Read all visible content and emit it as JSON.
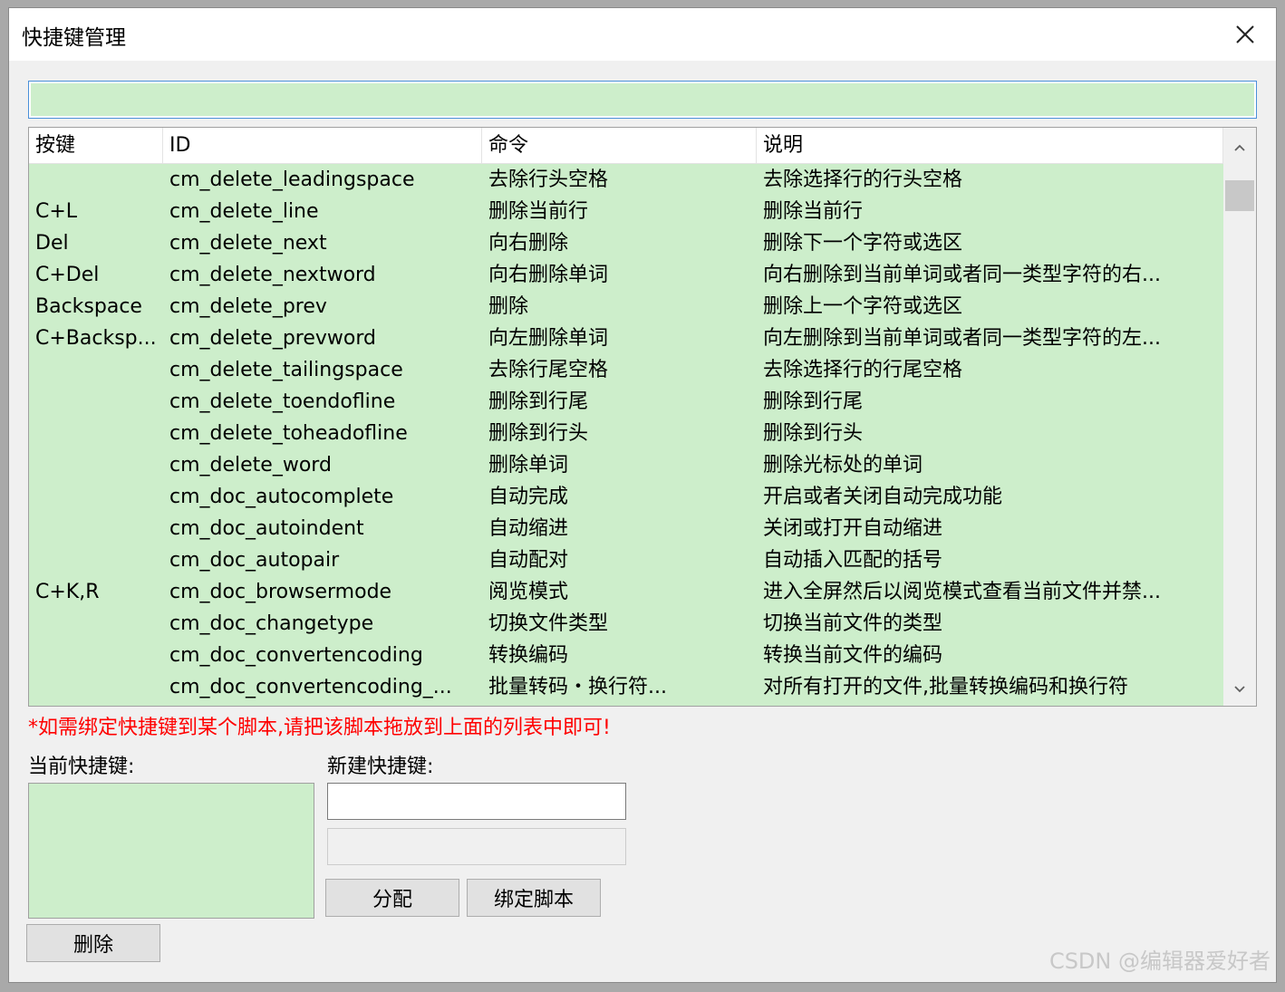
{
  "window": {
    "title": "快捷键管理"
  },
  "filter": {
    "value": ""
  },
  "columns": [
    "按键",
    "ID",
    "命令",
    "说明"
  ],
  "rows": [
    [
      "",
      "cm_delete_leadingspace",
      "去除行头空格",
      "去除选择行的行头空格"
    ],
    [
      "C+L",
      "cm_delete_line",
      "删除当前行",
      "删除当前行"
    ],
    [
      "Del",
      "cm_delete_next",
      "向右删除",
      "删除下一个字符或选区"
    ],
    [
      "C+Del",
      "cm_delete_nextword",
      "向右删除单词",
      "向右删除到当前单词或者同一类型字符的右..."
    ],
    [
      "Backspace",
      "cm_delete_prev",
      "删除",
      "删除上一个字符或选区"
    ],
    [
      "C+Backsp...",
      "cm_delete_prevword",
      "向左删除单词",
      "向左删除到当前单词或者同一类型字符的左..."
    ],
    [
      "",
      "cm_delete_tailingspace",
      "去除行尾空格",
      "去除选择行的行尾空格"
    ],
    [
      "",
      "cm_delete_toendofline",
      "删除到行尾",
      "删除到行尾"
    ],
    [
      "",
      "cm_delete_toheadofline",
      "删除到行头",
      "删除到行头"
    ],
    [
      "",
      "cm_delete_word",
      "删除单词",
      "删除光标处的单词"
    ],
    [
      "",
      "cm_doc_autocomplete",
      "自动完成",
      "开启或者关闭自动完成功能"
    ],
    [
      "",
      "cm_doc_autoindent",
      "自动缩进",
      "关闭或打开自动缩进"
    ],
    [
      "",
      "cm_doc_autopair",
      "自动配对",
      "自动插入匹配的括号"
    ],
    [
      "C+K,R",
      "cm_doc_browsermode",
      "阅览模式",
      "进入全屏然后以阅览模式查看当前文件并禁..."
    ],
    [
      "",
      "cm_doc_changetype",
      "切换文件类型",
      "切换当前文件的类型"
    ],
    [
      "",
      "cm_doc_convertencoding",
      "转换编码",
      "转换当前文件的编码"
    ],
    [
      "",
      "cm_doc_convertencoding_...",
      "批量转码・换行符...",
      "对所有打开的文件,批量转换编码和换行符"
    ]
  ],
  "hint": "*如需绑定快捷键到某个脚本,请把该脚本拖放到上面的列表中即可!",
  "current_label": "当前快捷键:",
  "new_label": "新建快捷键:",
  "buttons": {
    "assign": "分配",
    "bind_script": "绑定脚本",
    "delete": "删除"
  },
  "watermark": "CSDN @编辑器爱好者",
  "icons": {
    "close": "close-icon",
    "up": "chevron-up-icon",
    "down": "chevron-down-icon"
  },
  "colors": {
    "list_bg": "#cdeecb",
    "hint": "#ff0000",
    "focus_border": "#4a90d9"
  }
}
